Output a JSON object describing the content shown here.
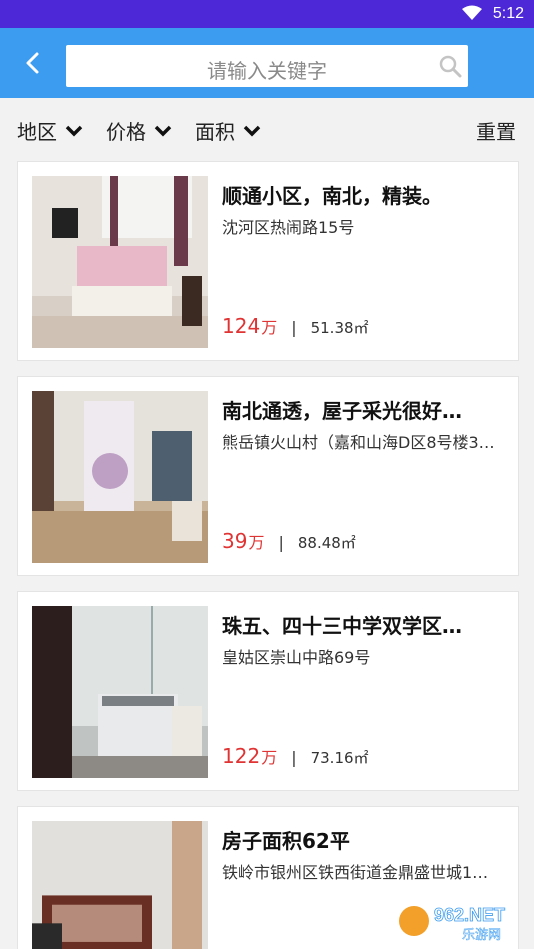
{
  "statusbar": {
    "time": "5:12"
  },
  "header": {
    "search_placeholder": "请输入关键字"
  },
  "filters": {
    "region": "地区",
    "price": "价格",
    "area": "面积",
    "reset": "重置"
  },
  "listings": [
    {
      "title": "顺通小区，南北，精装。",
      "address": "沈河区热闹路15号",
      "price": "124",
      "price_unit": "万",
      "area": "51.38㎡"
    },
    {
      "title": "南北通透，屋子采光很好…",
      "address": "熊岳镇火山村（嘉和山海D区8号楼3…",
      "price": "39",
      "price_unit": "万",
      "area": "88.48㎡"
    },
    {
      "title": "珠五、四十三中学双学区…",
      "address": "皇姑区崇山中路69号",
      "price": "122",
      "price_unit": "万",
      "area": "73.16㎡"
    },
    {
      "title": "房子面积62平",
      "address": "铁岭市银州区铁西街道金鼎盛世城1…",
      "price": "",
      "price_unit": "",
      "area": ""
    }
  ],
  "watermark": {
    "text_top": "962.NET",
    "text_bottom": "乐游网"
  },
  "colors": {
    "statusbar": "#4d28d6",
    "header": "#3b9cf0",
    "price": "#e03434"
  }
}
